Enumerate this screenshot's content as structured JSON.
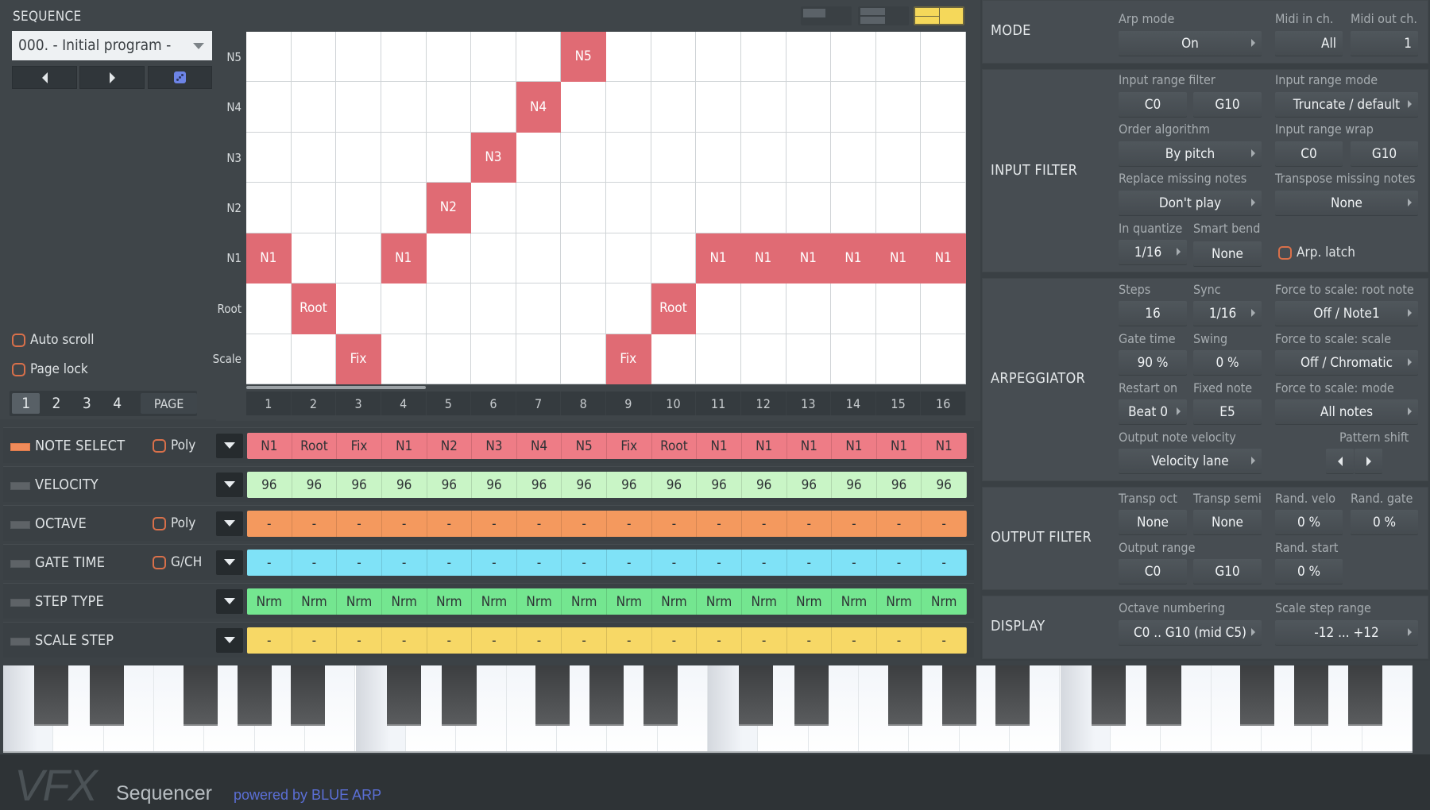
{
  "sequence": {
    "title": "SEQUENCE",
    "program": "000. - Initial program -",
    "prev_icon": "triangle-left-icon",
    "next_icon": "triangle-right-icon",
    "random_icon": "dice-icon"
  },
  "options": {
    "auto_scroll": {
      "label": "Auto scroll",
      "checked": false
    },
    "page_lock": {
      "label": "Page lock",
      "checked": false
    }
  },
  "pages": {
    "items": [
      "1",
      "2",
      "3",
      "4"
    ],
    "active": "1",
    "page_label": "PAGE"
  },
  "layout_buttons": [
    {
      "name": "layout-single",
      "active": false
    },
    {
      "name": "layout-split",
      "active": false
    },
    {
      "name": "layout-quad",
      "active": true
    }
  ],
  "grid": {
    "rows": [
      "N5",
      "N4",
      "N3",
      "N2",
      "N1",
      "Root",
      "Scale"
    ],
    "steps": [
      "1",
      "2",
      "3",
      "4",
      "5",
      "6",
      "7",
      "8",
      "9",
      "10",
      "11",
      "12",
      "13",
      "14",
      "15",
      "16"
    ],
    "cells": [
      {
        "step": 1,
        "row": "N1",
        "label": "N1"
      },
      {
        "step": 2,
        "row": "Root",
        "label": "Root"
      },
      {
        "step": 3,
        "row": "Scale",
        "label": "Fix"
      },
      {
        "step": 4,
        "row": "N1",
        "label": "N1"
      },
      {
        "step": 5,
        "row": "N2",
        "label": "N2"
      },
      {
        "step": 6,
        "row": "N3",
        "label": "N3"
      },
      {
        "step": 7,
        "row": "N4",
        "label": "N4"
      },
      {
        "step": 8,
        "row": "N5",
        "label": "N5"
      },
      {
        "step": 9,
        "row": "Scale",
        "label": "Fix"
      },
      {
        "step": 10,
        "row": "Root",
        "label": "Root"
      },
      {
        "step": 11,
        "row": "N1",
        "label": "N1"
      },
      {
        "step": 12,
        "row": "N1",
        "label": "N1"
      },
      {
        "step": 13,
        "row": "N1",
        "label": "N1"
      },
      {
        "step": 14,
        "row": "N1",
        "label": "N1"
      },
      {
        "step": 15,
        "row": "N1",
        "label": "N1"
      },
      {
        "step": 16,
        "row": "N1",
        "label": "N1"
      }
    ],
    "active_color": "#e06b74"
  },
  "lanes": [
    {
      "id": "note-select",
      "name": "NOTE SELECT",
      "active": true,
      "option": "Poly",
      "color": "#ee7c86",
      "values": [
        "N1",
        "Root",
        "Fix",
        "N1",
        "N2",
        "N3",
        "N4",
        "N5",
        "Fix",
        "Root",
        "N1",
        "N1",
        "N1",
        "N1",
        "N1",
        "N1"
      ]
    },
    {
      "id": "velocity",
      "name": "VELOCITY",
      "active": false,
      "option": null,
      "color": "#c9f5c6",
      "values": [
        "96",
        "96",
        "96",
        "96",
        "96",
        "96",
        "96",
        "96",
        "96",
        "96",
        "96",
        "96",
        "96",
        "96",
        "96",
        "96"
      ]
    },
    {
      "id": "octave",
      "name": "OCTAVE",
      "active": false,
      "option": "Poly",
      "color": "#f4995e",
      "values": [
        "-",
        "-",
        "-",
        "-",
        "-",
        "-",
        "-",
        "-",
        "-",
        "-",
        "-",
        "-",
        "-",
        "-",
        "-",
        "-"
      ]
    },
    {
      "id": "gate-time",
      "name": "GATE TIME",
      "active": false,
      "option": "G/CH",
      "color": "#7fe2f7",
      "values": [
        "-",
        "-",
        "-",
        "-",
        "-",
        "-",
        "-",
        "-",
        "-",
        "-",
        "-",
        "-",
        "-",
        "-",
        "-",
        "-"
      ]
    },
    {
      "id": "step-type",
      "name": "STEP TYPE",
      "active": false,
      "option": null,
      "color": "#74e690",
      "values": [
        "Nrm",
        "Nrm",
        "Nrm",
        "Nrm",
        "Nrm",
        "Nrm",
        "Nrm",
        "Nrm",
        "Nrm",
        "Nrm",
        "Nrm",
        "Nrm",
        "Nrm",
        "Nrm",
        "Nrm",
        "Nrm"
      ]
    },
    {
      "id": "scale-step",
      "name": "SCALE STEP",
      "active": false,
      "option": null,
      "color": "#f7d866",
      "values": [
        "-",
        "-",
        "-",
        "-",
        "-",
        "-",
        "-",
        "-",
        "-",
        "-",
        "-",
        "-",
        "-",
        "-",
        "-",
        "-"
      ]
    }
  ],
  "panel": {
    "mode": {
      "title": "MODE",
      "arp_mode": {
        "label": "Arp mode",
        "value": "On"
      },
      "midi_in": {
        "label": "Midi in ch.",
        "value": "All"
      },
      "midi_out": {
        "label": "Midi out ch.",
        "value": "1"
      }
    },
    "input_filter": {
      "title": "INPUT FILTER",
      "range_filter": {
        "label": "Input range filter",
        "low": "C0",
        "high": "G10"
      },
      "range_mode": {
        "label": "Input range mode",
        "value": "Truncate / default"
      },
      "order": {
        "label": "Order algorithm",
        "value": "By pitch"
      },
      "range_wrap": {
        "label": "Input range wrap",
        "low": "C0",
        "high": "G10"
      },
      "replace_missing": {
        "label": "Replace missing notes",
        "value": "Don't play"
      },
      "transpose_missing": {
        "label": "Transpose missing notes",
        "value": "None"
      },
      "in_quantize": {
        "label": "In quantize",
        "value": "1/16"
      },
      "smart_bend": {
        "label": "Smart bend",
        "value": "None"
      },
      "arp_latch": {
        "label": "Arp. latch",
        "checked": false
      }
    },
    "arpeggiator": {
      "title": "ARPEGGIATOR",
      "steps": {
        "label": "Steps",
        "value": "16"
      },
      "sync": {
        "label": "Sync",
        "value": "1/16"
      },
      "root_note": {
        "label": "Force to scale: root note",
        "value": "Off / Note1"
      },
      "gate": {
        "label": "Gate time",
        "value": "90 %"
      },
      "swing": {
        "label": "Swing",
        "value": "0 %"
      },
      "scale": {
        "label": "Force to scale: scale",
        "value": "Off / Chromatic"
      },
      "restart": {
        "label": "Restart on",
        "value": "Beat 0"
      },
      "fixed_note": {
        "label": "Fixed note",
        "value": "E5"
      },
      "scale_mode": {
        "label": "Force to scale: mode",
        "value": "All notes"
      },
      "out_velocity": {
        "label": "Output note velocity",
        "value": "Velocity lane"
      },
      "pattern_shift": {
        "label": "Pattern shift"
      }
    },
    "output_filter": {
      "title": "OUTPUT FILTER",
      "transp_oct": {
        "label": "Transp oct",
        "value": "None"
      },
      "transp_semi": {
        "label": "Transp semi",
        "value": "None"
      },
      "rand_velo": {
        "label": "Rand. velo",
        "value": "0 %"
      },
      "rand_gate": {
        "label": "Rand. gate",
        "value": "0 %"
      },
      "output_range": {
        "label": "Output range",
        "low": "C0",
        "high": "G10"
      },
      "rand_start": {
        "label": "Rand. start",
        "value": "0 %"
      }
    },
    "display": {
      "title": "DISPLAY",
      "octave_numbering": {
        "label": "Octave numbering",
        "value": "C0 .. G10 (mid C5)"
      },
      "scale_step_range": {
        "label": "Scale step range",
        "value": "-12 ... +12"
      }
    }
  },
  "keyboard": {
    "octaves": 4
  },
  "footer": {
    "logo": "VFX",
    "product": "Sequencer",
    "powered": "powered by BLUE ARP"
  }
}
